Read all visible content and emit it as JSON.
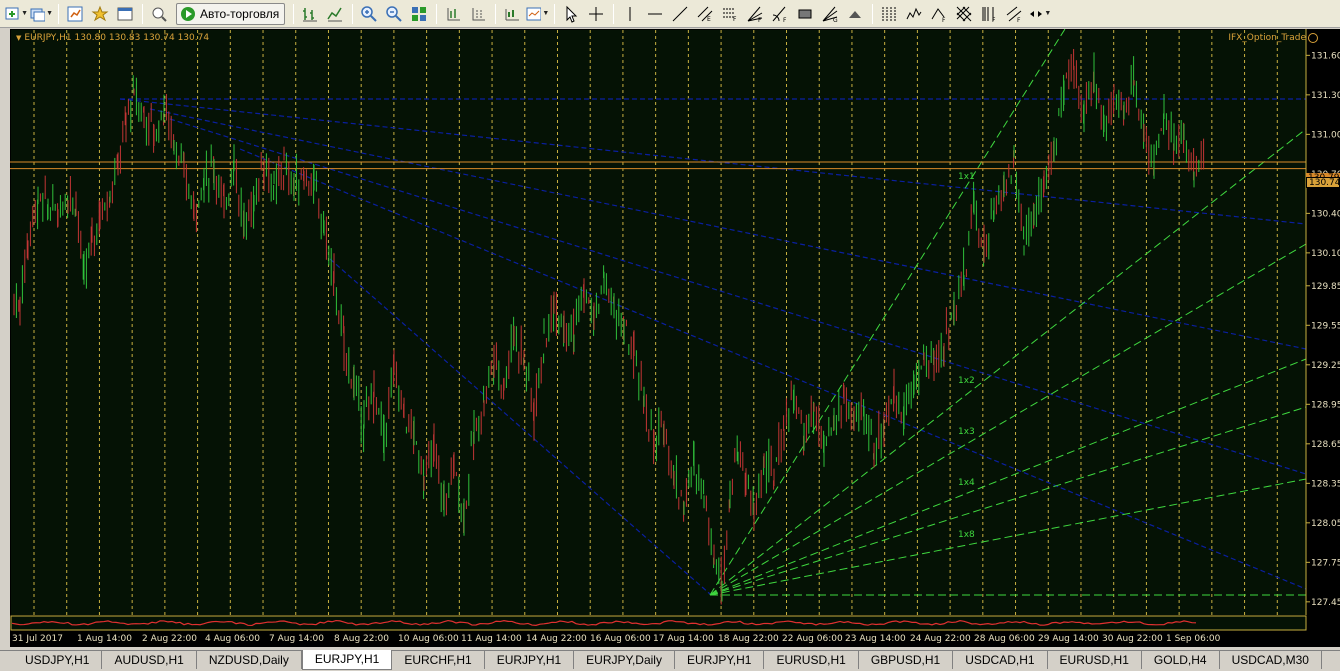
{
  "toolbar": {
    "auto_trading_label": "Авто-торговля"
  },
  "chart": {
    "header_text": "EURJPY,H1  130.80 130.83 130.74 130.74",
    "indicator_label": "IFX_Option_Trade",
    "current_price": "130.74",
    "bid_price": "130.79"
  },
  "tabs": [
    {
      "label": "USDJPY,H1"
    },
    {
      "label": "AUDUSD,H1"
    },
    {
      "label": "NZDUSD,Daily"
    },
    {
      "label": "EURJPY,H1"
    },
    {
      "label": "EURCHF,H1"
    },
    {
      "label": "EURJPY,H1"
    },
    {
      "label": "EURJPY,Daily"
    },
    {
      "label": "EURJPY,H1"
    },
    {
      "label": "EURUSD,H1"
    },
    {
      "label": "GBPUSD,H1"
    },
    {
      "label": "USDCAD,H1"
    },
    {
      "label": "EURUSD,H1"
    },
    {
      "label": "GOLD,H4"
    },
    {
      "label": "USDCAD,M30"
    }
  ],
  "active_tab_index": 3,
  "chart_data": {
    "type": "candlestick",
    "symbol": "EURJPY,H1",
    "y_ticks": [
      131.6,
      131.3,
      131.0,
      130.7,
      130.4,
      130.1,
      129.85,
      129.55,
      129.25,
      128.95,
      128.65,
      128.35,
      128.05,
      127.75,
      127.45
    ],
    "x_ticks": [
      "31 Jul 2017",
      "1 Aug 14:00",
      "2 Aug 22:00",
      "4 Aug 06:00",
      "7 Aug 14:00",
      "8 Aug 22:00",
      "10 Aug 06:00",
      "11 Aug 14:00",
      "14 Aug 22:00",
      "16 Aug 06:00",
      "17 Aug 14:00",
      "18 Aug 22:00",
      "22 Aug 06:00",
      "23 Aug 14:00",
      "24 Aug 22:00",
      "28 Aug 06:00",
      "29 Aug 14:00",
      "30 Aug 22:00",
      "1 Sep 06:00"
    ],
    "ylim": [
      127.35,
      131.8
    ],
    "horizontal_levels": [
      130.79,
      130.74
    ],
    "gann_labels": [
      "1x1",
      "1x2",
      "1x3",
      "1x4",
      "1x8"
    ],
    "price_path": [
      [
        0,
        129.75
      ],
      [
        6,
        129.7
      ],
      [
        14,
        130.2
      ],
      [
        24,
        130.5
      ],
      [
        34,
        130.45
      ],
      [
        44,
        130.4
      ],
      [
        54,
        130.55
      ],
      [
        62,
        130.5
      ],
      [
        70,
        129.9
      ],
      [
        78,
        130.2
      ],
      [
        86,
        130.4
      ],
      [
        96,
        130.55
      ],
      [
        104,
        130.75
      ],
      [
        112,
        131.1
      ],
      [
        120,
        131.3
      ],
      [
        130,
        131.15
      ],
      [
        140,
        131.0
      ],
      [
        150,
        131.2
      ],
      [
        160,
        130.95
      ],
      [
        170,
        130.7
      ],
      [
        180,
        130.45
      ],
      [
        190,
        130.65
      ],
      [
        200,
        130.75
      ],
      [
        210,
        130.45
      ],
      [
        220,
        130.8
      ],
      [
        230,
        130.3
      ],
      [
        240,
        130.5
      ],
      [
        250,
        130.8
      ],
      [
        260,
        130.55
      ],
      [
        270,
        130.75
      ],
      [
        280,
        130.6
      ],
      [
        290,
        130.7
      ],
      [
        300,
        130.6
      ],
      [
        310,
        130.3
      ],
      [
        320,
        129.9
      ],
      [
        330,
        129.4
      ],
      [
        340,
        129.1
      ],
      [
        350,
        128.8
      ],
      [
        360,
        129.05
      ],
      [
        370,
        128.7
      ],
      [
        380,
        129.2
      ],
      [
        390,
        128.9
      ],
      [
        400,
        128.7
      ],
      [
        410,
        128.4
      ],
      [
        420,
        128.6
      ],
      [
        430,
        128.2
      ],
      [
        440,
        128.5
      ],
      [
        450,
        128.1
      ],
      [
        460,
        128.7
      ],
      [
        470,
        129.0
      ],
      [
        480,
        129.3
      ],
      [
        490,
        129.1
      ],
      [
        500,
        129.5
      ],
      [
        510,
        129.3
      ],
      [
        520,
        128.9
      ],
      [
        530,
        129.4
      ],
      [
        540,
        129.7
      ],
      [
        550,
        129.6
      ],
      [
        560,
        129.5
      ],
      [
        570,
        129.8
      ],
      [
        580,
        129.6
      ],
      [
        590,
        129.9
      ],
      [
        600,
        129.7
      ],
      [
        610,
        129.5
      ],
      [
        620,
        129.3
      ],
      [
        630,
        129.0
      ],
      [
        640,
        128.6
      ],
      [
        650,
        128.8
      ],
      [
        660,
        128.4
      ],
      [
        670,
        128.2
      ],
      [
        680,
        128.5
      ],
      [
        690,
        128.3
      ],
      [
        700,
        127.8
      ],
      [
        708,
        127.6
      ],
      [
        716,
        128.3
      ],
      [
        724,
        128.6
      ],
      [
        732,
        128.4
      ],
      [
        740,
        128.1
      ],
      [
        750,
        128.5
      ],
      [
        760,
        128.4
      ],
      [
        770,
        128.8
      ],
      [
        780,
        129.0
      ],
      [
        790,
        128.7
      ],
      [
        800,
        128.9
      ],
      [
        810,
        128.6
      ],
      [
        820,
        128.8
      ],
      [
        830,
        129.0
      ],
      [
        840,
        128.8
      ],
      [
        850,
        128.9
      ],
      [
        860,
        128.6
      ],
      [
        870,
        128.8
      ],
      [
        880,
        129.0
      ],
      [
        890,
        128.9
      ],
      [
        900,
        129.1
      ],
      [
        910,
        129.3
      ],
      [
        920,
        129.25
      ],
      [
        930,
        129.4
      ],
      [
        940,
        129.7
      ],
      [
        950,
        129.9
      ],
      [
        960,
        130.5
      ],
      [
        970,
        130.1
      ],
      [
        980,
        130.4
      ],
      [
        990,
        130.6
      ],
      [
        1000,
        130.8
      ],
      [
        1010,
        130.2
      ],
      [
        1020,
        130.4
      ],
      [
        1030,
        130.6
      ],
      [
        1040,
        130.9
      ],
      [
        1050,
        131.3
      ],
      [
        1060,
        131.5
      ],
      [
        1070,
        131.2
      ],
      [
        1080,
        131.4
      ],
      [
        1090,
        131.1
      ],
      [
        1100,
        131.3
      ],
      [
        1110,
        131.2
      ],
      [
        1120,
        131.4
      ],
      [
        1130,
        131.0
      ],
      [
        1140,
        130.8
      ],
      [
        1150,
        131.1
      ],
      [
        1160,
        130.9
      ],
      [
        1170,
        131.0
      ],
      [
        1180,
        130.7
      ],
      [
        1190,
        130.8
      ]
    ]
  }
}
